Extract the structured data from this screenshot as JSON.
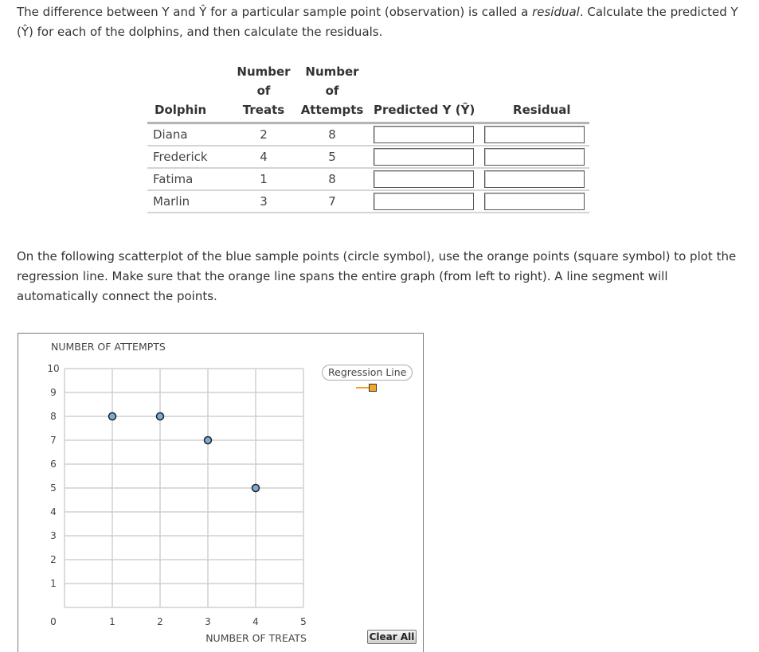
{
  "intro": {
    "part1": "The difference between Y and Ŷ for a particular sample point (observation) is called a ",
    "italic": "residual",
    "part2": ". Calculate the predicted Y (Ŷ) for each of the dolphins, and then calculate the residuals."
  },
  "table": {
    "headers": {
      "dolphin": "Dolphin",
      "treats_line1": "Number of",
      "treats_line2": "Treats",
      "attempts_line1": "Number of",
      "attempts_line2": "Attempts",
      "predicted": "Predicted Y (Ŷ)",
      "residual": "Residual"
    },
    "rows": [
      {
        "dolphin": "Diana",
        "treats": "2",
        "attempts": "8",
        "predicted": "",
        "residual": ""
      },
      {
        "dolphin": "Frederick",
        "treats": "4",
        "attempts": "5",
        "predicted": "",
        "residual": ""
      },
      {
        "dolphin": "Fatima",
        "treats": "1",
        "attempts": "8",
        "predicted": "",
        "residual": ""
      },
      {
        "dolphin": "Marlin",
        "treats": "3",
        "attempts": "7",
        "predicted": "",
        "residual": ""
      }
    ]
  },
  "instructions": "On the following scatterplot of the blue sample points (circle symbol), use the orange points (square symbol) to plot the regression line. Make sure that the orange line spans the entire graph (from left to right). A line segment will automatically connect the points.",
  "graph": {
    "legend_label": "Regression Line",
    "clear_button": "Clear All",
    "colors": {
      "sample_point": "#7aaad8",
      "regression": "#f5a623",
      "grid": "#d0d0d0"
    }
  },
  "chart_data": {
    "type": "scatter",
    "title": "",
    "xlabel": "NUMBER OF TREATS",
    "ylabel": "NUMBER OF ATTEMPTS",
    "xlim": [
      0,
      5
    ],
    "ylim": [
      0,
      10
    ],
    "xticks": [
      "0",
      "1",
      "2",
      "3",
      "4",
      "5"
    ],
    "yticks": [
      "10",
      "9",
      "8",
      "7",
      "6",
      "5",
      "4",
      "3",
      "2",
      "1"
    ],
    "grid": true,
    "legend": {
      "position": "top-right",
      "entries": [
        "Regression Line"
      ]
    },
    "series": [
      {
        "name": "Sample points",
        "marker": "circle",
        "points": [
          [
            1,
            8
          ],
          [
            2,
            8
          ],
          [
            3,
            7
          ],
          [
            4,
            5
          ]
        ]
      },
      {
        "name": "Regression Line",
        "marker": "square",
        "points": []
      }
    ]
  }
}
